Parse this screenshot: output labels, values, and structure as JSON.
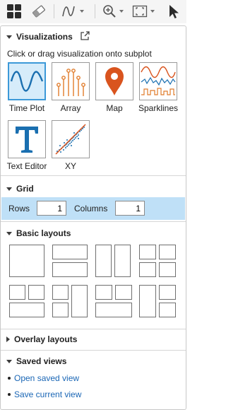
{
  "toolbar": {
    "icons": [
      "subplot-grid-icon",
      "eraser-icon",
      "signal-icon",
      "zoom-icon",
      "pan-region-icon",
      "pointer-icon"
    ]
  },
  "visualizations": {
    "title": "Visualizations",
    "hint": "Click or drag visualization onto subplot",
    "items": [
      {
        "label": "Time Plot",
        "icon": "time-plot-icon",
        "selected": true
      },
      {
        "label": "Array",
        "icon": "array-icon",
        "selected": false
      },
      {
        "label": "Map",
        "icon": "map-icon",
        "selected": false
      },
      {
        "label": "Sparklines",
        "icon": "sparklines-icon",
        "selected": false
      },
      {
        "label": "Text Editor",
        "icon": "text-editor-icon",
        "selected": false
      },
      {
        "label": "XY",
        "icon": "xy-icon",
        "selected": false
      }
    ]
  },
  "grid": {
    "title": "Grid",
    "rows_label": "Rows",
    "rows_value": "1",
    "columns_label": "Columns",
    "columns_value": "1"
  },
  "basic_layouts": {
    "title": "Basic layouts"
  },
  "overlay_layouts": {
    "title": "Overlay layouts"
  },
  "saved_views": {
    "title": "Saved views",
    "open": "Open saved view",
    "save": "Save current view"
  },
  "colors": {
    "accent": "#3c99d8",
    "selected_bg": "#bfe0f7",
    "link": "#1a66b5",
    "map_pin": "#d9541e"
  }
}
